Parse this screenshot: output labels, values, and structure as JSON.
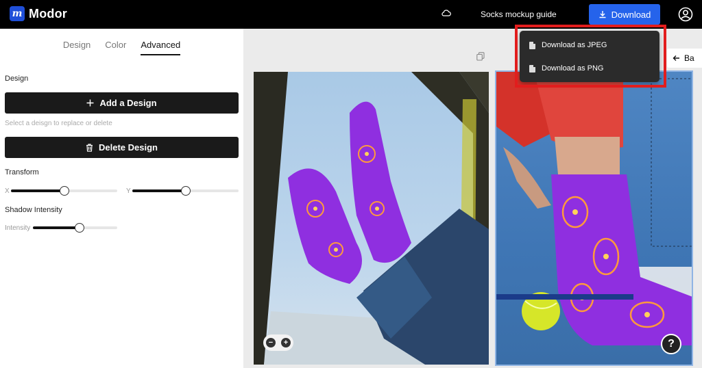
{
  "header": {
    "brand": "Modor",
    "brand_mark": "m",
    "guide_link": "Socks mockup guide",
    "download_label": "Download"
  },
  "tabs": [
    {
      "label": "Design"
    },
    {
      "label": "Color"
    },
    {
      "label": "Advanced",
      "active": true
    }
  ],
  "panel": {
    "design_section": "Design",
    "add_design_label": "Add a Design",
    "hint": "Select a deisgn to replace or delete",
    "delete_design_label": "Delete Design",
    "transform_section": "Transform",
    "x_label": "X",
    "y_label": "Y",
    "x_value": 0.5,
    "y_value": 0.5,
    "shadow_section": "Shadow Intensity",
    "intensity_label": "Intensity",
    "intensity_value": 0.55
  },
  "canvas": {
    "back_label": "Ba",
    "zoom_out": "−",
    "zoom_in": "+",
    "help": "?"
  },
  "download_menu": {
    "items": [
      {
        "label": "Download as JPEG",
        "icon": "jpeg-file-icon"
      },
      {
        "label": "Download as PNG",
        "icon": "png-file-icon"
      }
    ]
  },
  "colors": {
    "accent": "#2563eb",
    "highlight": "#e21d1d",
    "sock": "#8f2fe0"
  }
}
